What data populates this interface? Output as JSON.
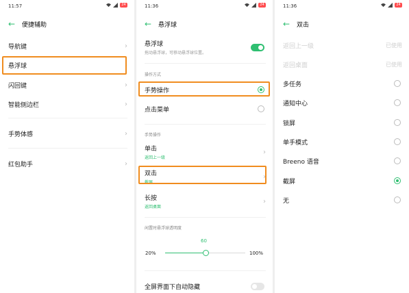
{
  "panel1": {
    "status": {
      "time": "11:57",
      "battery": "24"
    },
    "title": "便捷辅助",
    "items": [
      {
        "label": "导航键"
      },
      {
        "label": "悬浮球"
      },
      {
        "label": "闪回键"
      },
      {
        "label": "智能侧边栏"
      },
      {
        "label": "手势体感"
      },
      {
        "label": "红包助手"
      }
    ]
  },
  "panel2": {
    "status": {
      "time": "11:36",
      "battery": "24"
    },
    "title": "悬浮球",
    "float_ball": {
      "label": "悬浮球",
      "desc": "拖动悬浮球，可移动悬浮球位置。",
      "on": true
    },
    "section_mode": "操作方式",
    "mode_gesture": "手势操作",
    "mode_menu": "点击菜单",
    "section_gesture": "手势操作",
    "single": {
      "label": "单击",
      "sub": "返回上一级"
    },
    "double": {
      "label": "双击",
      "sub": "截屏"
    },
    "long": {
      "label": "长按",
      "sub": "返回桌面"
    },
    "opacity_label": "闲置时悬浮球透明度",
    "opacity": {
      "value": "60",
      "min": "20%",
      "max": "100%",
      "fraction": 0.5
    },
    "fullscreen_hide": "全屏界面下自动隐藏"
  },
  "panel3": {
    "status": {
      "time": "11:36",
      "battery": "24"
    },
    "title": "双击",
    "disabled": [
      {
        "label": "返回上一级",
        "tag": "已使用"
      },
      {
        "label": "返回桌面",
        "tag": "已使用"
      }
    ],
    "options": [
      {
        "label": "多任务",
        "selected": false
      },
      {
        "label": "通知中心",
        "selected": false
      },
      {
        "label": "锁屏",
        "selected": false
      },
      {
        "label": "单手模式",
        "selected": false
      },
      {
        "label": "Breeno 语音",
        "selected": false
      },
      {
        "label": "截屏",
        "selected": true
      },
      {
        "label": "无",
        "selected": false
      }
    ]
  },
  "colors": {
    "accent": "#2fbf71",
    "highlight": "#f08c1e",
    "battery": "#ff4d4f"
  }
}
